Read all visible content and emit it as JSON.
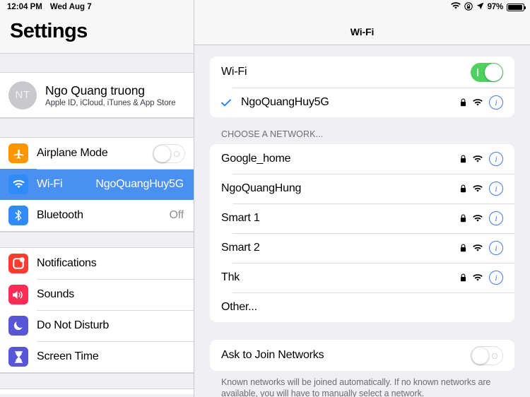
{
  "statusbar": {
    "time": "12:04 PM",
    "date": "Wed Aug 7",
    "battery_percent": "97%",
    "icons": [
      "wifi-icon",
      "rotation-lock-icon",
      "location-arrow-icon",
      "battery-icon"
    ]
  },
  "sidebar": {
    "title": "Settings",
    "account": {
      "initials": "NT",
      "name": "Ngo Quang truong",
      "subtitle": "Apple ID, iCloud, iTunes & App Store"
    },
    "group1": [
      {
        "label": "Airplane Mode",
        "icon": "airplane-icon",
        "icon_color": "#ff9500",
        "control": "toggle",
        "toggle_on": false,
        "selected": false
      },
      {
        "label": "Wi-Fi",
        "icon": "wifi-icon",
        "icon_color": "#2e8bf7",
        "value": "NgoQuangHuy5G",
        "selected": true
      },
      {
        "label": "Bluetooth",
        "icon": "bluetooth-icon",
        "icon_color": "#2e8bf7",
        "value": "Off",
        "selected": false
      }
    ],
    "group2": [
      {
        "label": "Notifications",
        "icon": "notifications-icon",
        "icon_color": "#ff3b30",
        "selected": false
      },
      {
        "label": "Sounds",
        "icon": "sounds-icon",
        "icon_color": "#fc2c55",
        "selected": false
      },
      {
        "label": "Do Not Disturb",
        "icon": "moon-icon",
        "icon_color": "#5856d6",
        "selected": false
      },
      {
        "label": "Screen Time",
        "icon": "hourglass-icon",
        "icon_color": "#5856d6",
        "selected": false
      }
    ]
  },
  "detail": {
    "nav_title": "Wi-Fi",
    "wifi_toggle": {
      "label": "Wi-Fi",
      "on": true
    },
    "connected_network": {
      "ssid": "NgoQuangHuy5G",
      "checked": true,
      "secured": true,
      "signal": "wifi-icon",
      "info": "info-icon"
    },
    "section_header": "CHOOSE A NETWORK...",
    "networks": [
      {
        "ssid": "Google_home",
        "secured": true
      },
      {
        "ssid": "NgoQuangHung",
        "secured": true
      },
      {
        "ssid": "Smart 1",
        "secured": true
      },
      {
        "ssid": "Smart 2",
        "secured": true
      },
      {
        "ssid": "Thk",
        "secured": true
      },
      {
        "ssid": "Other...",
        "secured": false
      }
    ],
    "ask_to_join": {
      "label": "Ask to Join Networks",
      "on": false
    },
    "footnote": "Known networks will be joined automatically. If no known networks are available, you will have to manually select a network."
  },
  "colors": {
    "accent_blue": "#3d7cf4",
    "selected_row": "#4a90f0",
    "toggle_green": "#4ed15f",
    "panel_bg": "#efeff4"
  }
}
